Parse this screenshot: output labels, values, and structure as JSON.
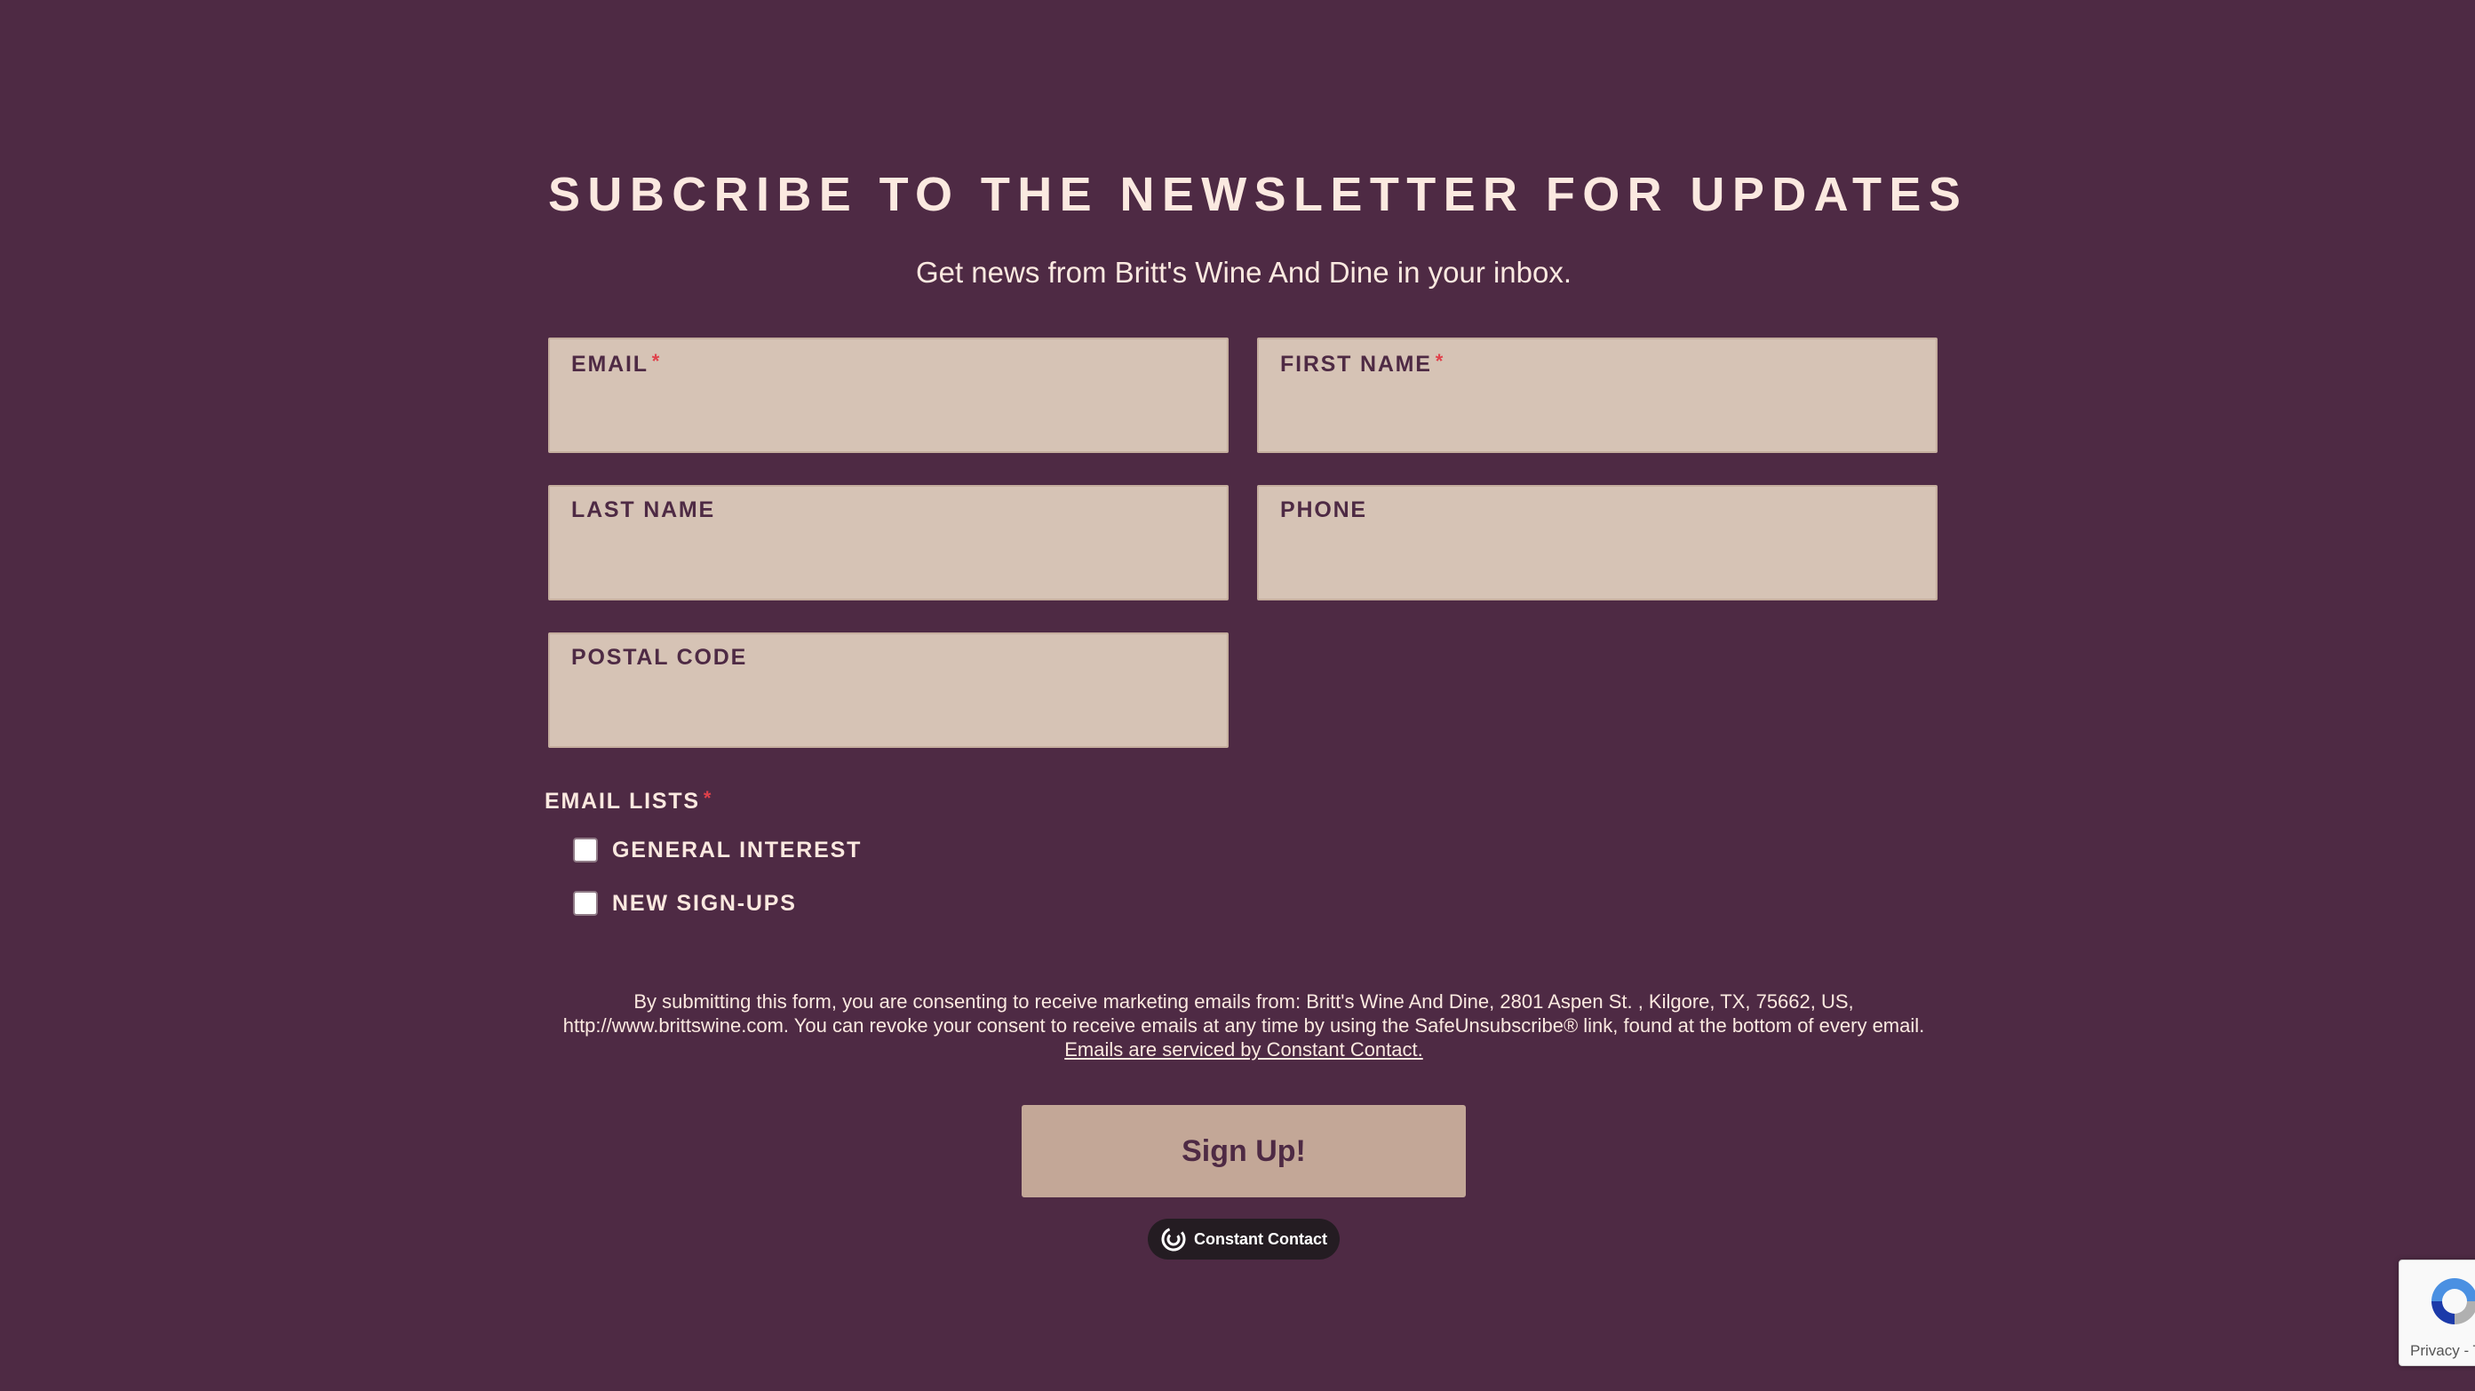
{
  "form": {
    "title": "SUBCRIBE TO THE NEWSLETTER FOR UPDATES",
    "subtitle": "Get news from Britt's Wine And Dine in your inbox.",
    "fields": [
      {
        "label": "EMAIL",
        "required_mark": "*",
        "value": ""
      },
      {
        "label": "FIRST NAME",
        "required_mark": "*",
        "value": ""
      },
      {
        "label": "LAST NAME",
        "value": ""
      },
      {
        "label": "PHONE",
        "value": ""
      },
      {
        "label": "POSTAL CODE",
        "value": ""
      }
    ],
    "email_lists": {
      "label": "EMAIL LISTS",
      "required_mark": "*",
      "options": [
        {
          "label": "GENERAL INTEREST",
          "checked": false
        },
        {
          "label": "NEW SIGN-UPS",
          "checked": false
        }
      ]
    },
    "consent": {
      "line1": "By submitting this form, you are consenting to receive marketing emails from: Britt's Wine And Dine, 2801 Aspen St. , Kilgore, TX, 75662, US,",
      "line2": "http://www.brittswine.com. You can revoke your consent to receive emails at any time by using the SafeUnsubscribe® link, found at the bottom of every email.",
      "link_text": "Emails are serviced by Constant Contact."
    },
    "submit_label": "Sign Up!",
    "badge_text": "Constant Contact"
  },
  "recaptcha": {
    "text": "Privacy - T"
  },
  "colors": {
    "background": "#4e2a44",
    "text": "#fbe9e0",
    "field_background": "#d6c3b5",
    "button_background": "#c3a797",
    "required": "#e0414b"
  },
  "icons": {
    "badge_logo": "constant-contact-logo-icon",
    "recaptcha_logo": "recaptcha-logo-icon"
  }
}
